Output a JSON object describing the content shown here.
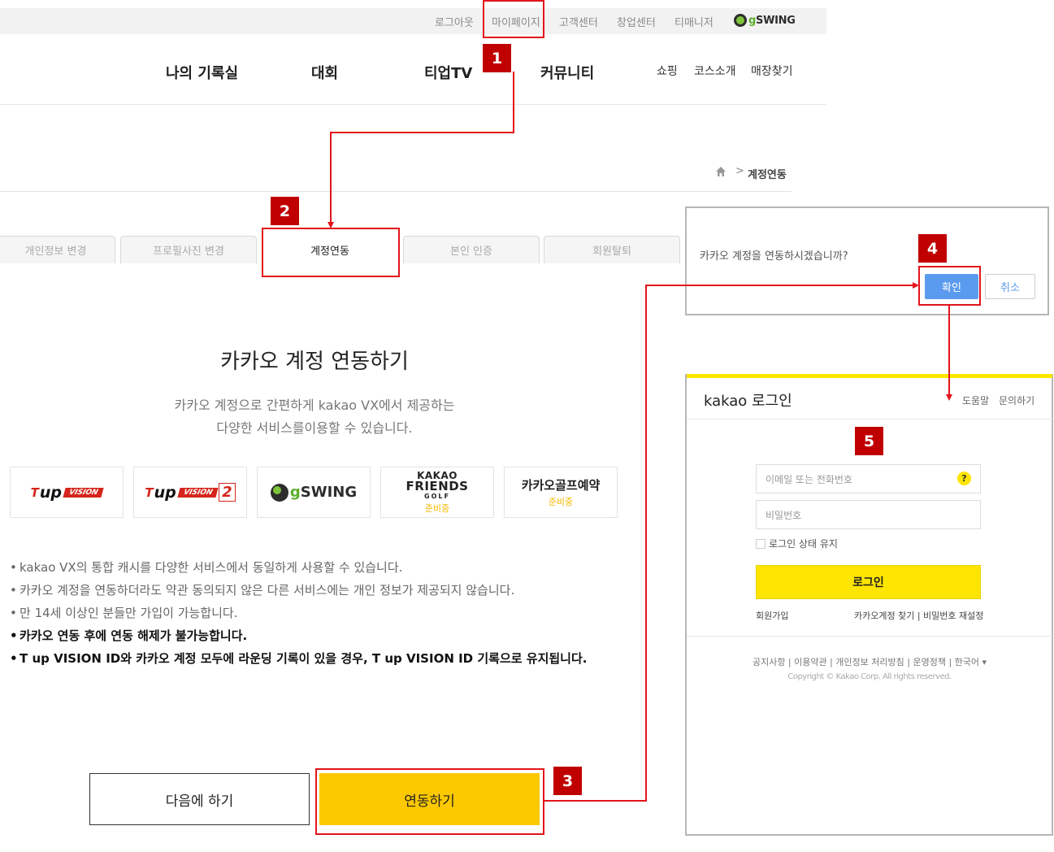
{
  "topbar": {
    "logout": "로그아웃",
    "mypage": "마이페이지",
    "customer_center": "고객센터",
    "startup_center": "창업센터",
    "timanager": "티매니저",
    "brand_g": "g",
    "brand_swing": "SWING"
  },
  "nav": {
    "items": [
      "나의 기록실",
      "대회",
      "티업TV",
      "커뮤니티"
    ],
    "sub": [
      "쇼핑",
      "코스소개",
      "매장찾기"
    ]
  },
  "breadcrumb": {
    "separator": ">",
    "current": "계정연동"
  },
  "tabs": [
    "개인정보 변경",
    "프로필사진 변경",
    "계정연동",
    "본인 인증",
    "회원탈퇴"
  ],
  "active_tab": "계정연동",
  "main": {
    "title": "카카오 계정 연동하기",
    "desc_line1": "카카오 계정으로 간편하게 kakao VX에서 제공하는",
    "desc_line2": "다양한 서비스를이용할 수 있습니다."
  },
  "logos": {
    "tup_t": "T",
    "tup_up": "up",
    "tup_vision": "VISION",
    "tup_two": "2",
    "gswing_g": "g",
    "gswing_swing": "SWING",
    "friends_kakao": "KAKAO",
    "friends_name": "FRIENDS",
    "friends_golf": "GOLF",
    "friends_soon": "준비중",
    "golf_reserve": "카카오골프예약",
    "golf_reserve_soon": "준비중"
  },
  "bullets": [
    "kakao VX의 통합 캐시를 다양한 서비스에서 동일하게 사용할 수 있습니다.",
    "카카오 계정을 연동하더라도 약관 동의되지 않은 다른 서비스에는 개인 정보가 제공되지 않습니다.",
    "만 14세 이상인 분들만 가입이 가능합니다.",
    "카카오 연동 후에 연동 해제가 불가능합니다.",
    "T up VISION ID와 카카오 계정 모두에 라운딩 기록이 있을 경우, T up VISION ID 기록으로 유지됩니다."
  ],
  "bullet_mark": "•",
  "buttons": {
    "later": "다음에 하기",
    "link": "연동하기"
  },
  "dialog": {
    "message": "카카오 계정을 연동하시겠습니까?",
    "ok": "확인",
    "cancel": "취소"
  },
  "kakao_login": {
    "brand": "kakao",
    "title": "로그인",
    "help": "도움말",
    "inquiry": "문의하기",
    "email_placeholder": "이메일 또는 전화번호",
    "help_mark": "?",
    "password_placeholder": "비밀번호",
    "keep_login": "로그인 상태 유지",
    "login_button": "로그인",
    "signup": "회원가입",
    "find_account": "카카오계정 찾기 | 비밀번호 재설정",
    "footer": "공지사항 | 이용약관 | 개인정보 처리방침 | 운영정책 | 한국어 ▾",
    "copyright": "Copyright © Kakao Corp. All rights reserved."
  },
  "steps": [
    "1",
    "2",
    "3",
    "4",
    "5"
  ],
  "colors": {
    "annotation_red": "#e3141c",
    "badge_red": "#c00000",
    "kakao_yellow": "#fee500",
    "link_yellow": "#fcc800",
    "dialog_blue": "#5b9bef"
  }
}
